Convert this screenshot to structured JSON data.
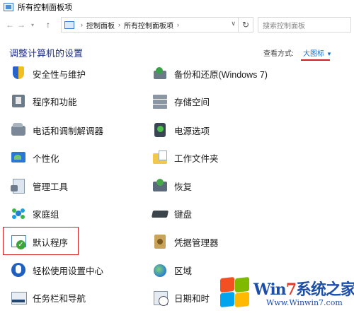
{
  "window": {
    "title": "所有控制面板项"
  },
  "address_bar": {
    "breadcrumbs": [
      "控制面板",
      "所有控制面板项"
    ],
    "search_placeholder": "搜索控制面板"
  },
  "header": {
    "title": "调整计算机的设置",
    "view_by_label": "查看方式:",
    "view_by_value": "大图标"
  },
  "items": {
    "security_maintenance": "安全性与维护",
    "backup_restore": "备份和还原(Windows 7)",
    "programs_features": "程序和功能",
    "storage_spaces": "存储空间",
    "phone_modem": "电话和调制解调器",
    "power_options": "电源选项",
    "personalization": "个性化",
    "work_folders": "工作文件夹",
    "admin_tools": "管理工具",
    "recovery": "恢复",
    "homegroup": "家庭组",
    "keyboard": "键盘",
    "default_programs": "默认程序",
    "credential_manager": "凭据管理器",
    "ease_of_access": "轻松使用设置中心",
    "region": "区域",
    "taskbar_navigation": "任务栏和导航",
    "date_time": "日期和时"
  },
  "watermark": {
    "brand_prefix": "Win",
    "brand_seven": "7",
    "brand_suffix": "系统之家",
    "url": "Www.Winwin7.com"
  },
  "colors": {
    "accent_link": "#1a6fc7",
    "title_blue": "#1e3287",
    "highlight_red": "#d42020"
  }
}
